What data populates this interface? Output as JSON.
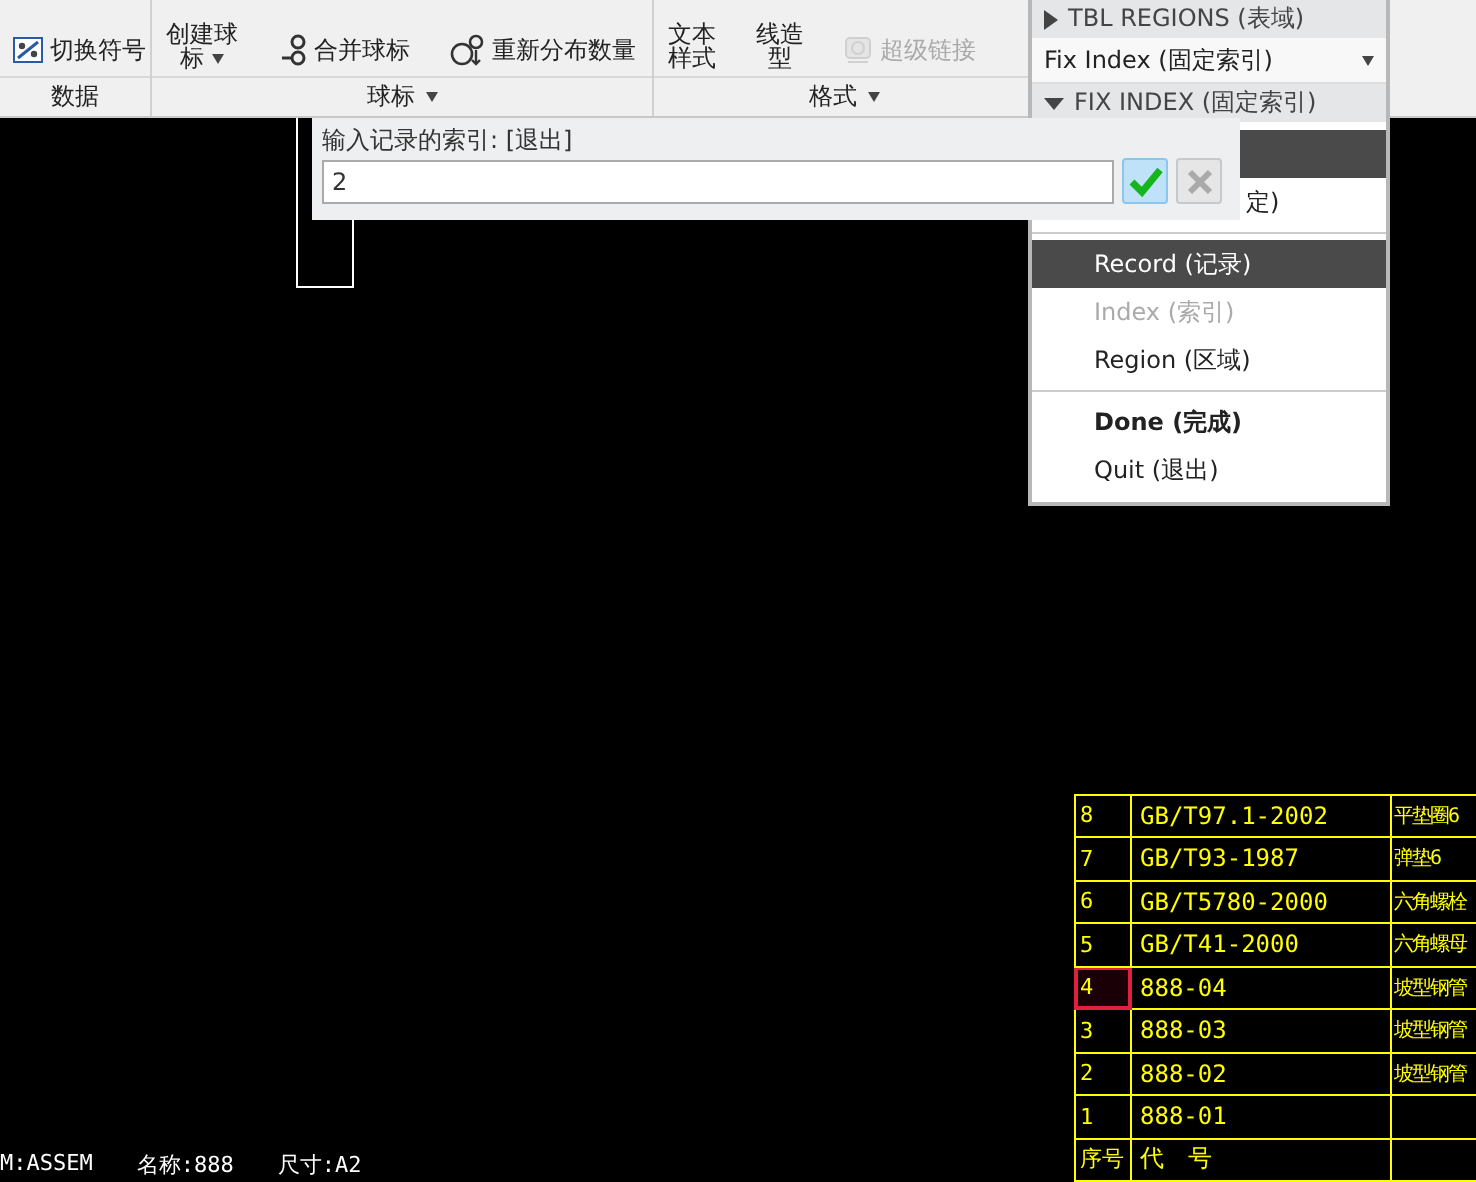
{
  "ribbon": {
    "groups": [
      {
        "label": "数据",
        "dropdown": false,
        "tools": [
          {
            "kind": "small",
            "label": "切换符号",
            "disabled": false
          }
        ]
      },
      {
        "label": "球标",
        "dropdown": true,
        "tools": [
          {
            "kind": "large-dropdown",
            "label": "创建球标",
            "disabled": false
          },
          {
            "kind": "small",
            "label": "合并球标",
            "disabled": false
          },
          {
            "kind": "small",
            "label": "重新分布数量",
            "disabled": false
          }
        ]
      },
      {
        "label": "格式",
        "dropdown": true,
        "tools": [
          {
            "kind": "large",
            "label": "文本样式",
            "disabled": false
          },
          {
            "kind": "large",
            "label": "线造型",
            "disabled": false
          },
          {
            "kind": "small",
            "label": "超级链接",
            "disabled": true
          }
        ]
      }
    ]
  },
  "menu_manager": {
    "sections": [
      {
        "kind": "header",
        "label": "TBL REGIONS (表域)",
        "expanded": false
      },
      {
        "kind": "dropdown",
        "value": "Fix Index (固定索引)"
      },
      {
        "kind": "header",
        "label": "FIX INDEX (固定索引)",
        "expanded": true
      }
    ],
    "items": [
      {
        "kind": "covered",
        "selected": true
      },
      {
        "kind": "partial",
        "label": "定)",
        "selected": false
      },
      {
        "kind": "divider"
      },
      {
        "kind": "item",
        "label": "Record (记录)",
        "selected": true,
        "disabled": false
      },
      {
        "kind": "item",
        "label": "Index (索引)",
        "selected": false,
        "disabled": true
      },
      {
        "kind": "item",
        "label": "Region (区域)",
        "selected": false,
        "disabled": false
      },
      {
        "kind": "divider"
      },
      {
        "kind": "bold",
        "label": "Done (完成)",
        "selected": false,
        "disabled": false
      },
      {
        "kind": "item",
        "label": "Quit (退出)",
        "selected": false,
        "disabled": false
      }
    ]
  },
  "prompt": {
    "label": "输入记录的索引: [退出]",
    "value": "2",
    "ok_disabled": false,
    "cancel_disabled": true
  },
  "bom_table": {
    "rows": [
      {
        "cells": [
          "8",
          "GB/T97.1-2002",
          "平垫圈6"
        ],
        "selected": false
      },
      {
        "cells": [
          "7",
          "GB/T93-1987",
          "弹垫6"
        ],
        "selected": false
      },
      {
        "cells": [
          "6",
          "GB/T5780-2000",
          "六角螺栓"
        ],
        "selected": false
      },
      {
        "cells": [
          "5",
          "GB/T41-2000",
          "六角螺母"
        ],
        "selected": false
      },
      {
        "cells": [
          "4",
          "888-04",
          "坡型钢管"
        ],
        "selected": true
      },
      {
        "cells": [
          "3",
          "888-03",
          "坡型钢管"
        ],
        "selected": false
      },
      {
        "cells": [
          "2",
          "888-02",
          "坡型钢管"
        ],
        "selected": false
      },
      {
        "cells": [
          "1",
          "888-01"
        ],
        "selected": false
      },
      {
        "cells": [
          "序号",
          "代　号"
        ],
        "selected": false
      }
    ]
  },
  "status": [
    "M:ASSEM",
    "名称:888",
    "尺寸:A2"
  ]
}
